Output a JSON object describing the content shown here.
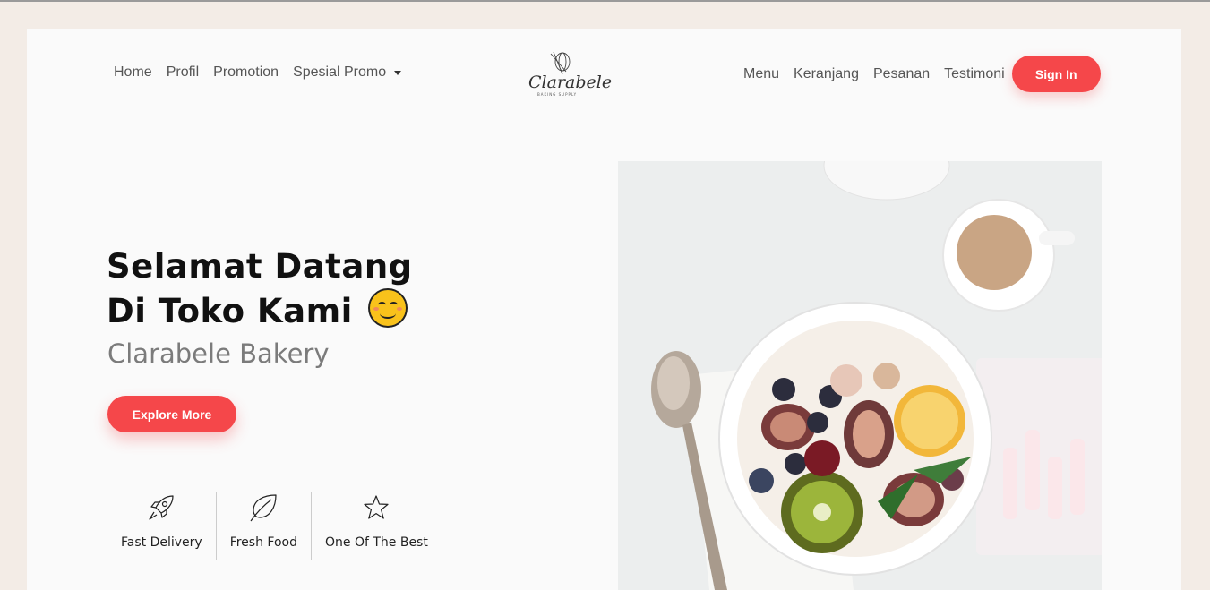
{
  "nav": {
    "left": [
      "Home",
      "Profil",
      "Promotion",
      "Spesial Promo"
    ],
    "right": [
      "Menu",
      "Keranjang",
      "Pesanan",
      "Testimoni"
    ],
    "signin": "Sign In"
  },
  "logo": {
    "name": "Clarabele",
    "tagline": "BAKING SUPPLY"
  },
  "hero": {
    "title_line1": "Selamat Datang",
    "title_line2": "Di Toko Kami",
    "subtitle": "Clarabele Bakery",
    "cta": "Explore More"
  },
  "features": [
    {
      "label": "Fast Delivery",
      "icon": "rocket-icon"
    },
    {
      "label": "Fresh Food",
      "icon": "leaf-icon"
    },
    {
      "label": "One Of The Best",
      "icon": "star-icon"
    }
  ],
  "colors": {
    "accent": "#f5474a",
    "page_bg": "#f3ece6",
    "card_bg": "#fafafa"
  }
}
